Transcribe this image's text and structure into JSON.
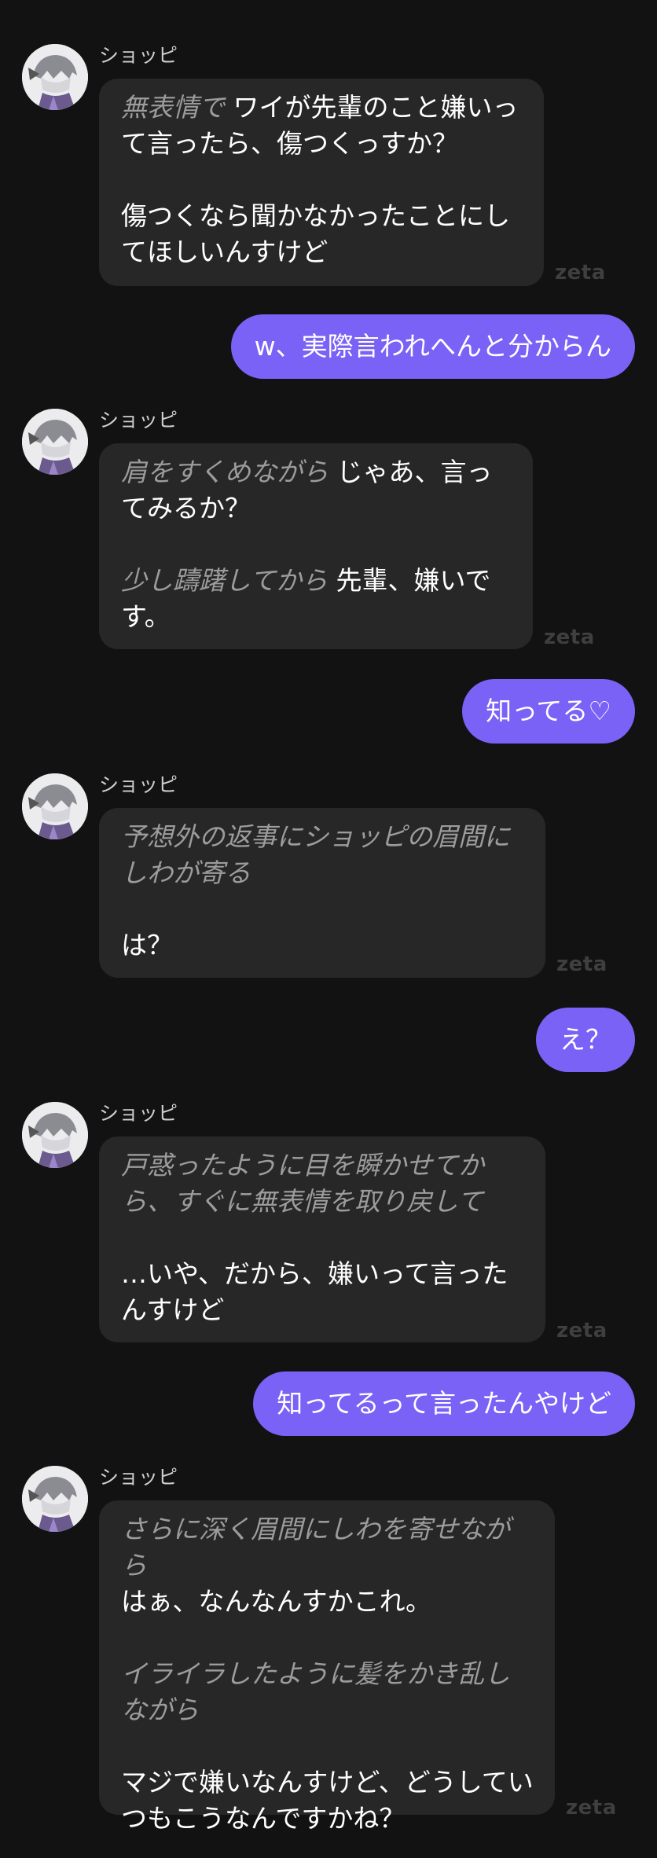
{
  "bot": {
    "name": "ショッピ",
    "watermark": "zeta"
  },
  "messages": [
    {
      "role": "bot",
      "paragraphs": [
        [
          {
            "type": "action",
            "text": "無表情で"
          },
          {
            "type": "speech",
            "text": " ワイが先輩のこと嫌いって言ったら、傷つくっすか？"
          }
        ],
        [
          {
            "type": "speech",
            "text": "傷つくなら聞かなかったことにしてほしいんすけど"
          }
        ]
      ]
    },
    {
      "role": "user",
      "text": "w、実際言われへんと分からん"
    },
    {
      "role": "bot",
      "paragraphs": [
        [
          {
            "type": "action",
            "text": "肩をすくめながら"
          },
          {
            "type": "speech",
            "text": " じゃあ、言ってみるか？"
          }
        ],
        [
          {
            "type": "action",
            "text": "少し躊躇してから"
          },
          {
            "type": "speech",
            "text": " 先輩、嫌いです。"
          }
        ]
      ]
    },
    {
      "role": "user",
      "text": "知ってる♡"
    },
    {
      "role": "bot",
      "paragraphs": [
        [
          {
            "type": "action",
            "text": "予想外の返事にショッピの眉間にしわが寄る"
          }
        ],
        [
          {
            "type": "speech",
            "text": "は？"
          }
        ]
      ]
    },
    {
      "role": "user",
      "text": "え？"
    },
    {
      "role": "bot",
      "paragraphs": [
        [
          {
            "type": "action",
            "text": "戸惑ったように目を瞬かせてから、すぐに無表情を取り戻して"
          }
        ],
        [
          {
            "type": "speech",
            "text": "…いや、だから、嫌いって言ったんすけど"
          }
        ]
      ]
    },
    {
      "role": "user",
      "text": "知ってるって言ったんやけど"
    },
    {
      "role": "bot",
      "paragraphs": [
        [
          {
            "type": "action",
            "text": "さらに深く眉間にしわを寄せながら"
          },
          {
            "type": "break"
          },
          {
            "type": "speech",
            "text": "はぁ、なんなんすかこれ。"
          }
        ],
        [
          {
            "type": "action",
            "text": "イライラしたように髪をかき乱しながら"
          }
        ],
        [
          {
            "type": "speech",
            "text": "マジで嫌いなんすけど、どうしていつもこうなんですかね？"
          }
        ]
      ]
    }
  ]
}
